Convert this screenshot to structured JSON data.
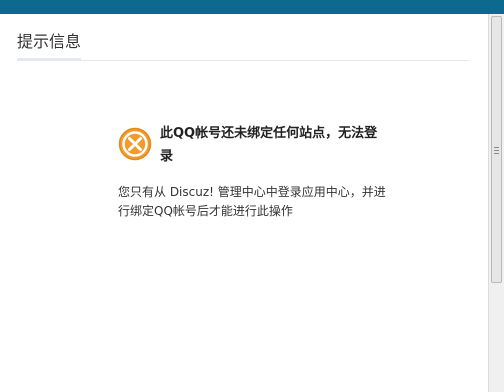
{
  "panel": {
    "title": "提示信息"
  },
  "message": {
    "title": "此QQ帐号还未绑定任何站点，无法登录",
    "body": "您只有从 Discuz! 管理中心中登录应用中心，并进行绑定QQ帐号后才能进行此操作",
    "icon": "error-x-icon"
  },
  "colors": {
    "top_bar": "#0d6a8f",
    "icon_orange": "#f29b2b"
  }
}
